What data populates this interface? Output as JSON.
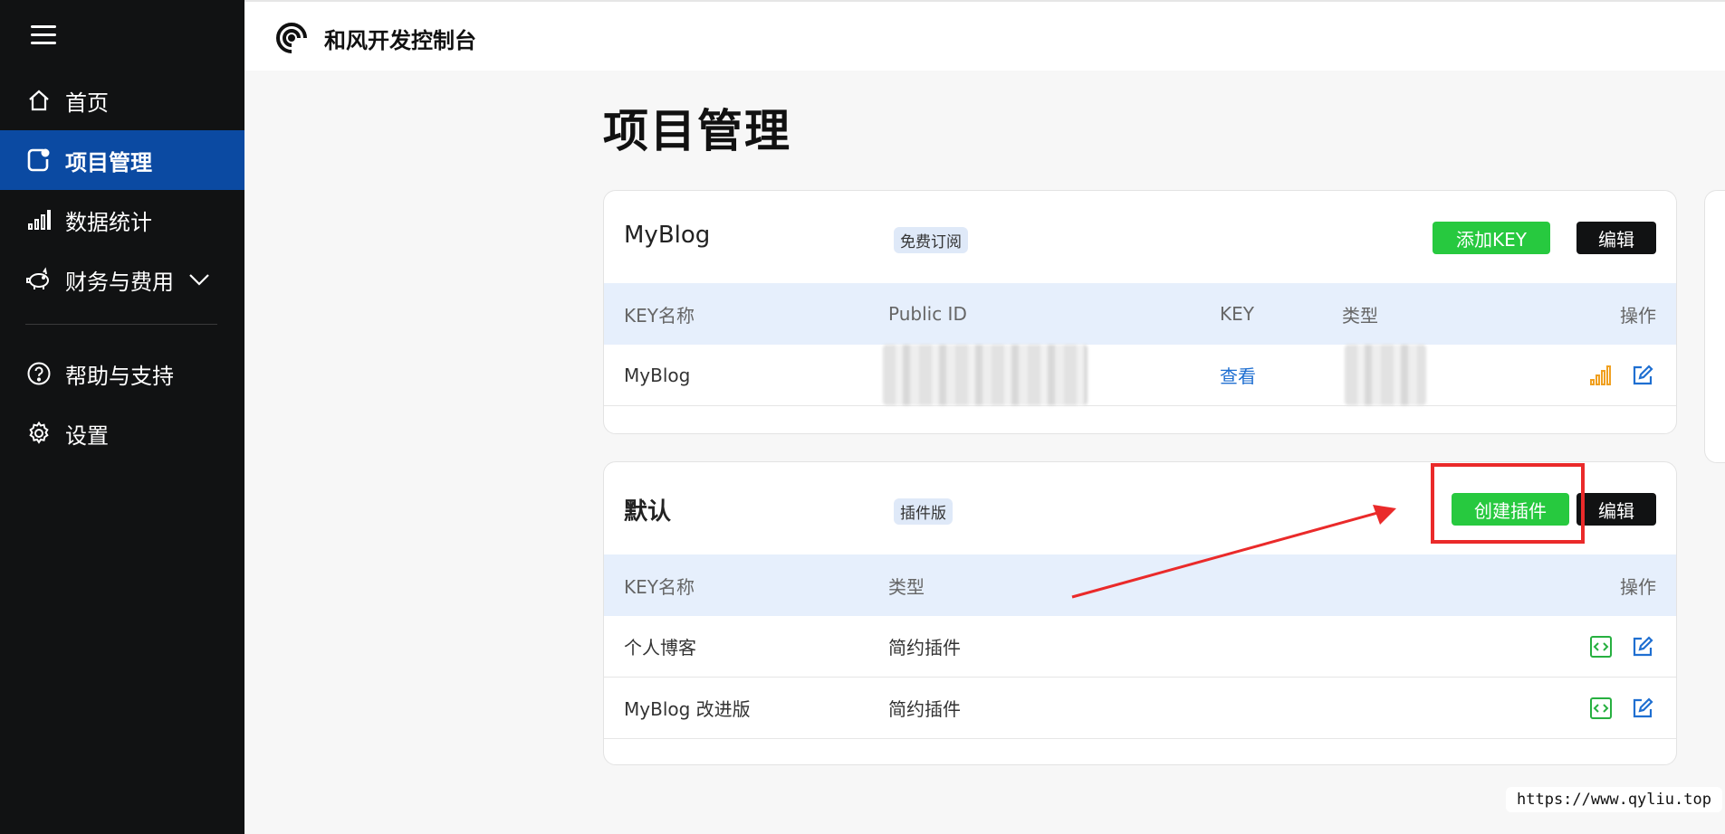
{
  "sidebar": {
    "items": [
      {
        "label": "首页"
      },
      {
        "label": "项目管理"
      },
      {
        "label": "数据统计"
      },
      {
        "label": "财务与费用"
      },
      {
        "label": "帮助与支持"
      },
      {
        "label": "设置"
      }
    ],
    "active_color": "#0b4aa2"
  },
  "topbar": {
    "brand": "和风开发控制台"
  },
  "page": {
    "title": "项目管理"
  },
  "project1": {
    "name": "MyBlog",
    "badge": "免费订阅",
    "add_key_button": "添加KEY",
    "edit_button": "编辑",
    "columns": [
      "KEY名称",
      "Public ID",
      "KEY",
      "类型",
      "操作"
    ],
    "rows": [
      {
        "key_name": "MyBlog",
        "public_id": "",
        "key_link": "查看",
        "type": ""
      }
    ]
  },
  "project2": {
    "name": "默认",
    "badge": "插件版",
    "create_plugin_button": "创建插件",
    "edit_button": "编辑",
    "columns": [
      "KEY名称",
      "类型",
      "操作"
    ],
    "rows": [
      {
        "key_name": "个人博客",
        "type": "简约插件"
      },
      {
        "key_name": "MyBlog 改进版",
        "type": "简约插件"
      }
    ]
  },
  "watermark": "https://www.qyliu.top",
  "colors": {
    "green": "#27c93f",
    "dark": "#111213",
    "table_header": "#e6effc",
    "annotation_red": "#ea2a2a"
  }
}
